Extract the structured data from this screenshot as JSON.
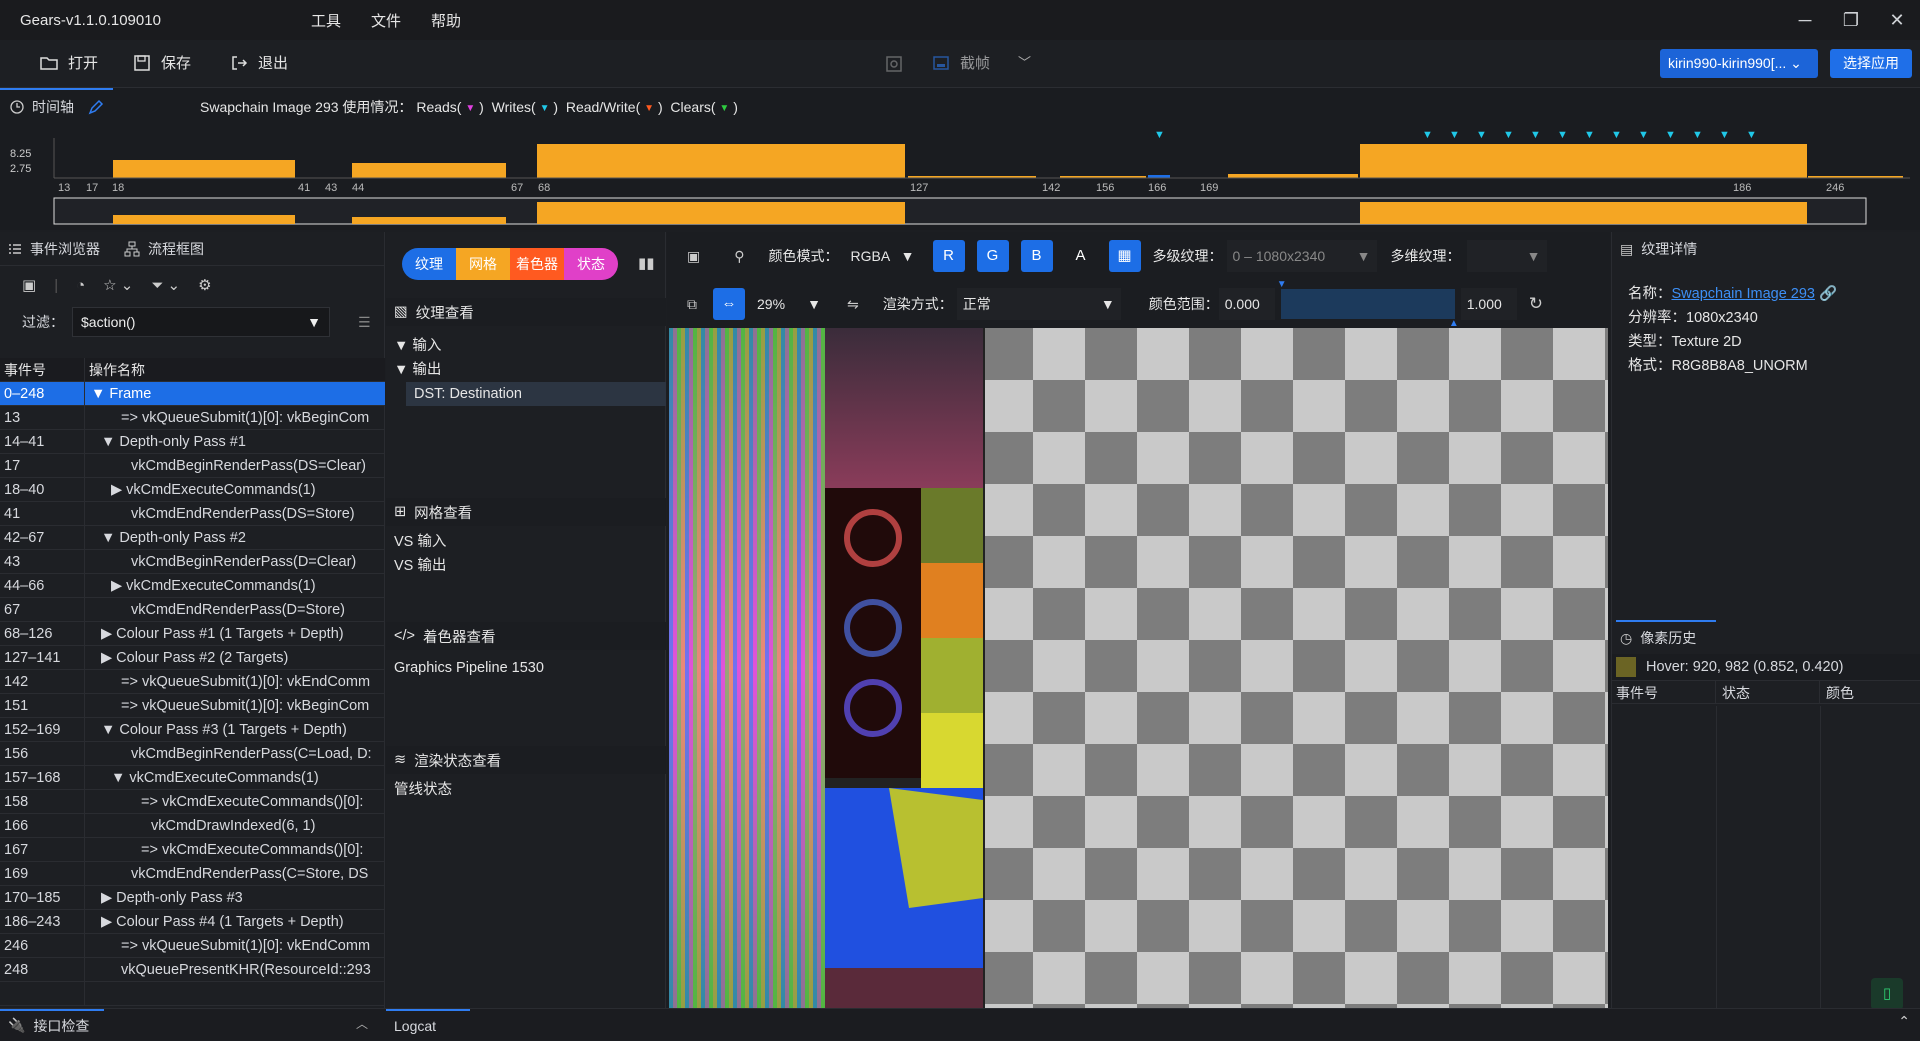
{
  "app": {
    "title": "Gears-v1.1.0.109010",
    "menus": [
      "工具",
      "文件",
      "帮助"
    ]
  },
  "toolbar": {
    "open": "打开",
    "save": "保存",
    "exit": "退出",
    "capture": "截帧",
    "device": "kirin990-kirin990[...",
    "select_app": "选择应用"
  },
  "timeline": {
    "tab": "时间轴",
    "usage_prefix": "Swapchain Image 293  使用情况：",
    "usage_items": [
      {
        "label": "Reads(",
        "color": "#e040e0"
      },
      {
        "label": "Writes(",
        "color": "#20c8e8"
      },
      {
        "label": "Read/Write(",
        "color": "#ff5a20"
      },
      {
        "label": "Clears(",
        "color": "#2ecc40"
      }
    ],
    "ytick_top": "8.25",
    "ytick_bottom": "2.75",
    "bar_color": "#f5a623",
    "write_color": "#20c8e8",
    "axis_labels": [
      "13",
      "17",
      "18",
      "41",
      "43",
      "44",
      "67",
      "68",
      "127",
      "142",
      "156",
      "166",
      "169",
      "186",
      "246"
    ]
  },
  "events": {
    "tab_browser": "事件浏览器",
    "tab_flow": "流程框图",
    "filter_label": "过滤：",
    "filter_value": "$action()",
    "col_id": "事件号",
    "col_name": "操作名称",
    "rows": [
      {
        "id": "0–248",
        "name": "▼  Frame",
        "indent": 0,
        "sel": true
      },
      {
        "id": "13",
        "name": "=> vkQueueSubmit(1)[0]: vkBeginCom",
        "indent": 3
      },
      {
        "id": "14–41",
        "name": "▼  Depth-only Pass #1",
        "indent": 1
      },
      {
        "id": "17",
        "name": "vkCmdBeginRenderPass(DS=Clear)",
        "indent": 4
      },
      {
        "id": "18–40",
        "name": "▶  vkCmdExecuteCommands(1)",
        "indent": 2
      },
      {
        "id": "41",
        "name": "vkCmdEndRenderPass(DS=Store)",
        "indent": 4
      },
      {
        "id": "42–67",
        "name": "▼  Depth-only Pass #2",
        "indent": 1
      },
      {
        "id": "43",
        "name": "vkCmdBeginRenderPass(D=Clear)",
        "indent": 4
      },
      {
        "id": "44–66",
        "name": "▶  vkCmdExecuteCommands(1)",
        "indent": 2
      },
      {
        "id": "67",
        "name": "vkCmdEndRenderPass(D=Store)",
        "indent": 4
      },
      {
        "id": "68–126",
        "name": "▶  Colour Pass #1 (1 Targets + Depth)",
        "indent": 1
      },
      {
        "id": "127–141",
        "name": "▶  Colour Pass #2 (2 Targets)",
        "indent": 1
      },
      {
        "id": "142",
        "name": "=> vkQueueSubmit(1)[0]: vkEndComm",
        "indent": 3
      },
      {
        "id": "151",
        "name": "=> vkQueueSubmit(1)[0]: vkBeginCom",
        "indent": 3
      },
      {
        "id": "152–169",
        "name": "▼  Colour Pass #3 (1 Targets + Depth)",
        "indent": 1
      },
      {
        "id": "156",
        "name": "vkCmdBeginRenderPass(C=Load, D:",
        "indent": 4
      },
      {
        "id": "157–168",
        "name": "▼  vkCmdExecuteCommands(1)",
        "indent": 2
      },
      {
        "id": "158",
        "name": "=> vkCmdExecuteCommands()[0]:",
        "indent": 5
      },
      {
        "id": "166",
        "name": "vkCmdDrawIndexed(6, 1)",
        "indent": 6
      },
      {
        "id": "167",
        "name": "=> vkCmdExecuteCommands()[0]:",
        "indent": 5
      },
      {
        "id": "169",
        "name": "vkCmdEndRenderPass(C=Store, DS",
        "indent": 4
      },
      {
        "id": "170–185",
        "name": "▶  Depth-only Pass #3",
        "indent": 1
      },
      {
        "id": "186–243",
        "name": "▶  Colour Pass #4 (1 Targets + Depth)",
        "indent": 1
      },
      {
        "id": "246",
        "name": "=> vkQueueSubmit(1)[0]: vkEndComm",
        "indent": 3
      },
      {
        "id": "248",
        "name": "vkQueuePresentKHR(ResourceId::293",
        "indent": 3
      }
    ]
  },
  "modes": {
    "tabs": [
      {
        "label": "纹理",
        "color": "#1d6ee6"
      },
      {
        "label": "网格",
        "color": "#f5a623"
      },
      {
        "label": "着色器",
        "color": "#ff5a20"
      },
      {
        "label": "状态",
        "color": "#e040c8"
      }
    ]
  },
  "inspect": {
    "texture_title": "纹理查看",
    "input": "▼  输入",
    "output": "▼  输出",
    "dst": "DST: Destination",
    "mesh_title": "网格查看",
    "vs_in": "VS 输入",
    "vs_out": "VS 输出",
    "shader_title": "着色器查看",
    "pipeline": "Graphics Pipeline 1530",
    "state_title": "渲染状态查看",
    "pipeline_state": "管线状态"
  },
  "texview": {
    "color_mode_label": "颜色模式：",
    "color_mode": "RGBA",
    "ch_r": "R",
    "ch_g": "G",
    "ch_b": "B",
    "ch_a": "A",
    "mip_label": "多级纹理：",
    "mip_value": "0 – 1080x2340",
    "slice_label": "多维纹理：",
    "zoom": "29%",
    "render_label": "渲染方式：",
    "render_value": "正常",
    "range_label": "颜色范围：",
    "range_min": "0.000",
    "range_max": "1.000"
  },
  "details": {
    "title": "纹理详情",
    "name_label": "名称：",
    "name_value": "Swapchain Image 293",
    "res_label": "分辨率：",
    "res_value": "1080x2340",
    "type_label": "类型：",
    "type_value": "Texture 2D",
    "fmt_label": "格式：",
    "fmt_value": "R8G8B8A8_UNORM",
    "hist_title": "像素历史",
    "hover": "Hover: 920, 982 (0.852, 0.420)",
    "hover_color": "#6b6424",
    "col_event": "事件号",
    "col_state": "状态",
    "col_color": "颜色"
  },
  "bottom": {
    "api_check": "接口检查",
    "logcat": "Logcat"
  }
}
